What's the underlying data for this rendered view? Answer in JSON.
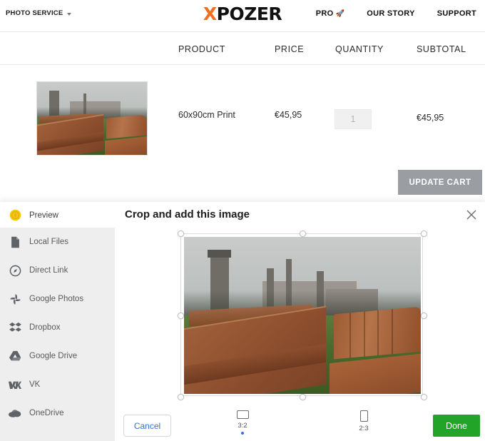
{
  "header": {
    "photo_service_label": "PHOTO SERVICE",
    "logo_x": "X",
    "logo_rest": "POZER",
    "logo_accent_color": "#f07022",
    "nav": [
      {
        "label": "PRO",
        "icon": "rocket-icon",
        "glyph": "🚀"
      },
      {
        "label": "OUR STORY",
        "icon": "",
        "glyph": ""
      },
      {
        "label": "SUPPORT",
        "icon": "",
        "glyph": ""
      }
    ]
  },
  "cart": {
    "columns": [
      "PRODUCT",
      "PRICE",
      "QUANTITY",
      "SUBTOTAL"
    ],
    "rows": [
      {
        "product": "60x90cm Print",
        "price": "€45,95",
        "quantity": "1",
        "subtotal": "€45,95",
        "thumbnail_alt": "garden benches and table with Cardiff Castle"
      }
    ],
    "update_cart_label": "UPDATE CART",
    "update_cart_color": "#9a9ea3"
  },
  "modal": {
    "title": "Crop and add this image",
    "close_icon": "close-icon",
    "sidebar": [
      {
        "label": "Preview",
        "icon": "preview-icon",
        "active": true
      },
      {
        "label": "Local Files",
        "icon": "file-icon",
        "active": false
      },
      {
        "label": "Direct Link",
        "icon": "link-compass-icon",
        "active": false
      },
      {
        "label": "Google Photos",
        "icon": "google-photos-icon",
        "active": false
      },
      {
        "label": "Dropbox",
        "icon": "dropbox-icon",
        "active": false
      },
      {
        "label": "Google Drive",
        "icon": "google-drive-icon",
        "active": false
      },
      {
        "label": "VK",
        "icon": "vk-icon",
        "active": false
      },
      {
        "label": "OneDrive",
        "icon": "onedrive-icon",
        "active": false
      }
    ],
    "crop": {
      "image_alt": "garden benches and table with Cardiff Castle",
      "handles": [
        "top-left",
        "top-center",
        "top-right",
        "middle-left",
        "middle-right",
        "bottom-left",
        "bottom-center",
        "bottom-right"
      ]
    },
    "footer": {
      "cancel_label": "Cancel",
      "done_label": "Done",
      "done_color": "#21a428",
      "cancel_text_color": "#3272d9",
      "ratios": [
        {
          "label": "3:2",
          "orientation": "landscape",
          "selected": true
        },
        {
          "label": "2:3",
          "orientation": "portrait",
          "selected": false
        }
      ]
    }
  }
}
